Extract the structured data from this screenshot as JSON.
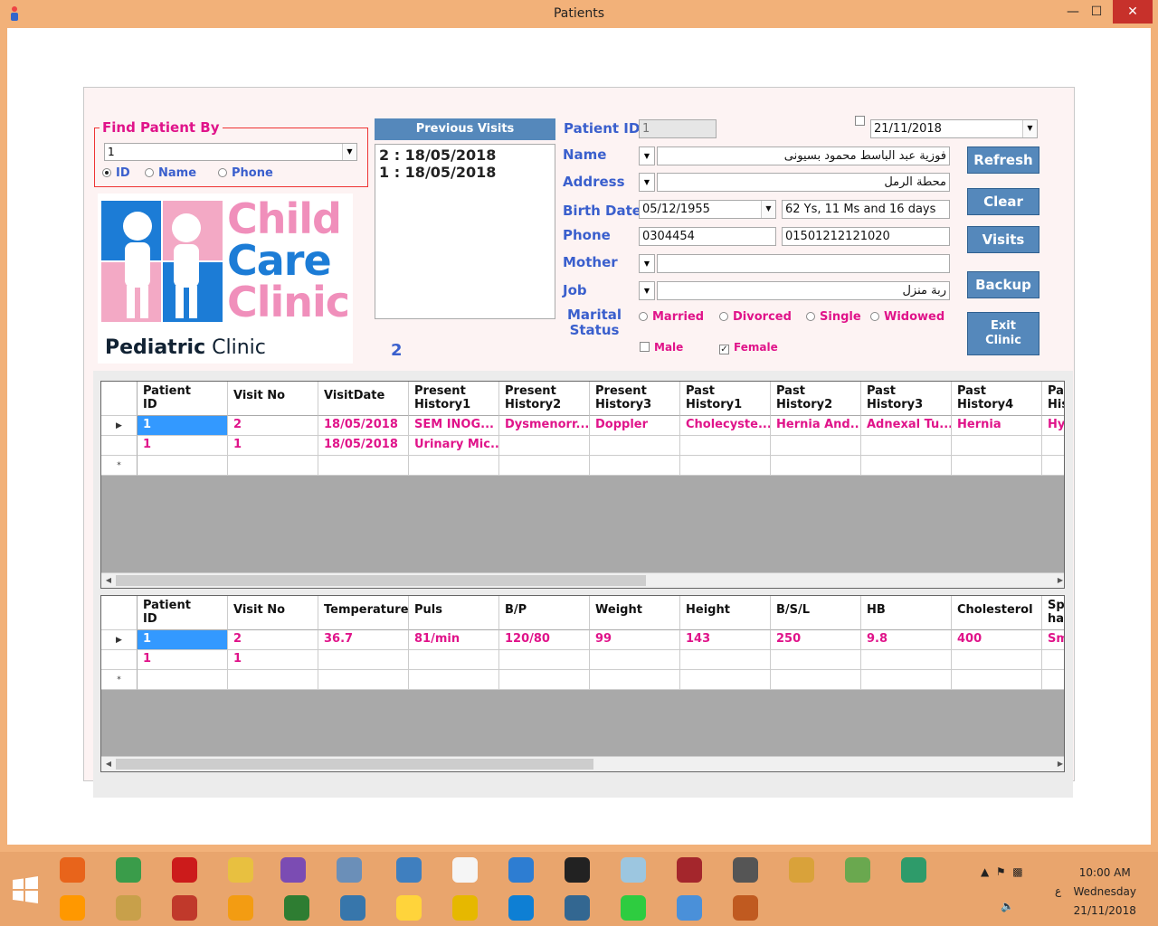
{
  "window": {
    "title": "Patients"
  },
  "find": {
    "legend": "Find Patient By",
    "value": "1",
    "options": [
      "ID",
      "Name",
      "Phone"
    ]
  },
  "logo": {
    "line1": "Child",
    "line2": "Care",
    "line3": "Clinic",
    "sub_bold": "Pediatric",
    "sub_rest": " Clinic"
  },
  "previous_visits": {
    "header": "Previous Visits",
    "items": [
      "2 : 18/05/2018",
      "1 : 18/05/2018"
    ],
    "count": "2"
  },
  "form": {
    "patient_id_label": "Patient ID",
    "patient_id": "1",
    "date": "21/11/2018",
    "name_label": "Name",
    "name": "فوزية عبد الباسط محمود بسيونى",
    "address_label": "Address",
    "address": "محطة الرمل",
    "birth_label": "Birth Date",
    "birth": "05/12/1955",
    "age": "62 Ys, 11 Ms and 16 days",
    "phone_label": "Phone",
    "phone1": "0304454",
    "phone2": "01501212121020",
    "mother_label": "Mother",
    "mother": "",
    "job_label": "Job",
    "job": "ربة منزل",
    "marital_label_1": "Marital",
    "marital_label_2": "Status",
    "marital_options": [
      "Married",
      "Divorced",
      "Single",
      "Widowed"
    ],
    "gender_options": [
      "Male",
      "Female"
    ]
  },
  "buttons": {
    "refresh": "Refresh",
    "clear": "Clear",
    "visits": "Visits",
    "backup": "Backup",
    "exit_1": "Exit",
    "exit_2": "Clinic"
  },
  "grid1": {
    "headers": [
      [
        "Patient",
        "ID"
      ],
      [
        "Visit No",
        ""
      ],
      [
        "VisitDate",
        ""
      ],
      [
        "Present",
        "History1"
      ],
      [
        "Present",
        "History2"
      ],
      [
        "Present",
        "History3"
      ],
      [
        "Past",
        "History1"
      ],
      [
        "Past",
        "History2"
      ],
      [
        "Past",
        "History3"
      ],
      [
        "Past",
        "History4"
      ],
      [
        "Pa",
        "His"
      ]
    ],
    "rows": [
      [
        "1",
        "2",
        "18/05/2018",
        "SEM INOG...",
        "Dysmenorr...",
        "Doppler",
        "Cholecyste...",
        "Hernia And...",
        "Adnexal Tu...",
        "Hernia",
        "Hys"
      ],
      [
        "1",
        "1",
        "18/05/2018",
        "Urinary Mic...",
        "",
        "",
        "",
        "",
        "",
        "",
        ""
      ]
    ]
  },
  "grid2": {
    "headers": [
      [
        "Patient",
        "ID"
      ],
      [
        "Visit No",
        ""
      ],
      [
        "Temperature",
        ""
      ],
      [
        "Puls",
        ""
      ],
      [
        "B/P",
        ""
      ],
      [
        "Weight",
        ""
      ],
      [
        "Height",
        ""
      ],
      [
        "B/S/L",
        ""
      ],
      [
        "HB",
        ""
      ],
      [
        "Cholesterol",
        ""
      ],
      [
        "Sp",
        "hal"
      ]
    ],
    "rows": [
      [
        "1",
        "2",
        "36.7",
        "81/min",
        "120/80",
        "99",
        "143",
        "250",
        "9.8",
        "400",
        "Sm"
      ],
      [
        "1",
        "1",
        "",
        "",
        "",
        "",
        "",
        "",
        "",
        "",
        ""
      ]
    ]
  },
  "taskbar": {
    "time": "10:00 AM",
    "day": "Wednesday",
    "date": "21/11/2018",
    "lang": "ع"
  },
  "colors": {
    "accent": "#3a5fcd",
    "pink": "#e0148a",
    "button": "#5588bb",
    "chrome": "#f2b179"
  }
}
